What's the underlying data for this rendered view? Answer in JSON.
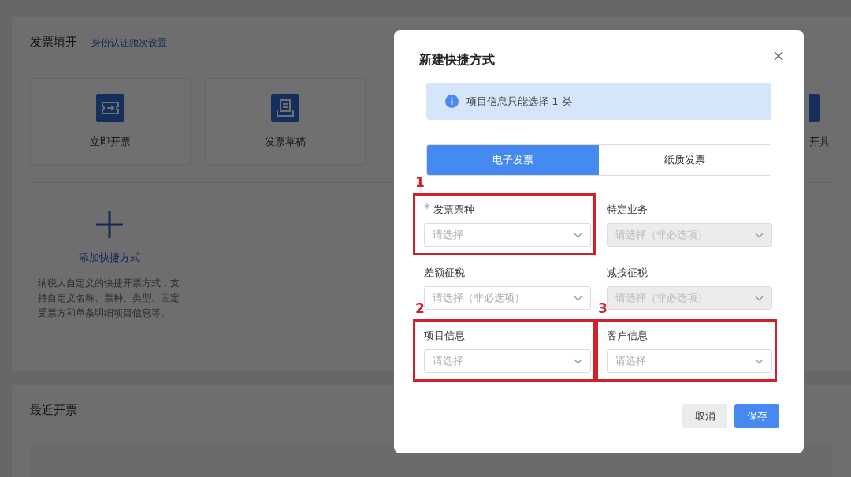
{
  "page": {
    "title": "发票填开",
    "link": "身份认证频次设置",
    "shortcuts": [
      {
        "label": "立即开票",
        "kind": "issue"
      },
      {
        "label": "发票草稿",
        "kind": "draft"
      },
      {
        "label": "开具",
        "kind": "partial"
      }
    ],
    "add_shortcut": {
      "label": "添加快捷方式",
      "description": "纳税人自定义的快捷开票方式，支持自定义名称、票种、类型、固定受票方和单条明细项目信息等。"
    },
    "recent": {
      "title": "最近开票"
    }
  },
  "dialog": {
    "title": "新建快捷方式",
    "alert": "项目信息只能选择 1 类",
    "tabs": [
      {
        "label": "电子发票",
        "selected": true
      },
      {
        "label": "纸质发票",
        "selected": false
      }
    ],
    "fields": [
      {
        "label": "发票票种",
        "placeholder": "请选择",
        "required_mark": "*",
        "disabled": false,
        "annotation": "1"
      },
      {
        "label": "特定业务",
        "placeholder": "请选择（非必选项）",
        "disabled": true
      },
      {
        "label": "差额征税",
        "placeholder": "请选择（非必选项）",
        "disabled": false
      },
      {
        "label": "减按征税",
        "placeholder": "请选择（非必选项）",
        "disabled": true
      },
      {
        "label": "项目信息",
        "placeholder": "请选择",
        "disabled": false,
        "annotation": "2"
      },
      {
        "label": "客户信息",
        "placeholder": "请选择",
        "disabled": false,
        "annotation": "3"
      }
    ],
    "buttons": [
      {
        "label": "取消",
        "kind": "secondary"
      },
      {
        "label": "保存",
        "kind": "primary"
      }
    ]
  }
}
